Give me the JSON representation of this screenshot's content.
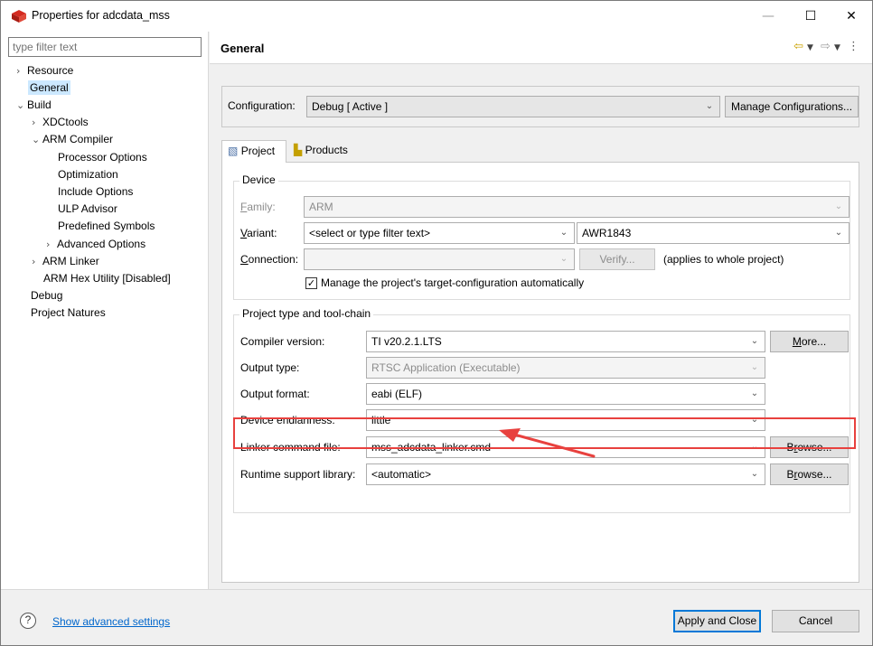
{
  "window": {
    "title": "Properties for adcdata_mss",
    "minimize": "—",
    "maximize": "☐",
    "close": "✕"
  },
  "filter": {
    "placeholder": "type filter text"
  },
  "tree": [
    {
      "label": "Resource",
      "chev": "›"
    },
    {
      "label": "General",
      "chev": ""
    },
    {
      "label": "Build",
      "chev": "⌄"
    },
    {
      "label": "XDCtools",
      "chev": "›"
    },
    {
      "label": "ARM Compiler",
      "chev": "⌄"
    },
    {
      "label": "Processor Options",
      "chev": ""
    },
    {
      "label": "Optimization",
      "chev": ""
    },
    {
      "label": "Include Options",
      "chev": ""
    },
    {
      "label": "ULP Advisor",
      "chev": ""
    },
    {
      "label": "Predefined Symbols",
      "chev": ""
    },
    {
      "label": "Advanced Options",
      "chev": "›"
    },
    {
      "label": "ARM Linker",
      "chev": "›"
    },
    {
      "label": "ARM Hex Utility  [Disabled]",
      "chev": ""
    },
    {
      "label": "Debug",
      "chev": ""
    },
    {
      "label": "Project Natures",
      "chev": ""
    }
  ],
  "page": {
    "title": "General"
  },
  "configuration": {
    "label": "Configuration:",
    "value": "Debug  [ Active ]",
    "manage_button": "Manage Configurations..."
  },
  "tabs": [
    {
      "label": "Project"
    },
    {
      "label": "Products"
    }
  ],
  "device": {
    "group_title": "Device",
    "family_label_u": "F",
    "family_label_rest": "amily:",
    "family_value": "ARM",
    "variant_label_u": "V",
    "variant_label_rest": "ariant:",
    "variant_filter": "<select or type filter text>",
    "variant_value": "AWR1843",
    "connection_label_u": "C",
    "connection_label_rest": "onnection:",
    "connection_value": "",
    "verify_button": "Verify...",
    "applies_note": "(applies to whole project)",
    "manage_checkbox": "Manage the project's target-configuration automatically",
    "manage_checked": "✓"
  },
  "toolchain": {
    "group_title": "Project type and tool-chain",
    "compiler_label": "Compiler version:",
    "compiler_value": "TI v20.2.1.LTS",
    "more_button_u": "M",
    "more_button_rest": "ore...",
    "output_type_label": "Output type:",
    "output_type_value": "RTSC Application (Executable)",
    "output_format_label": "Output format:",
    "output_format_value": "eabi (ELF)",
    "endianness_label": "Device endianness:",
    "endianness_value": "little",
    "linker_label": "Linker command file:",
    "linker_value": "mss_adcdata_linker.cmd",
    "browse_button_a": "B",
    "browse_button_u": "r",
    "browse_button_rest": "owse...",
    "runtime_label": "Runtime support library:",
    "runtime_value": "<automatic>"
  },
  "bottom": {
    "help_icon": "?",
    "advanced_link": "Show advanced settings",
    "apply_button": "Apply and Close",
    "cancel_button": "Cancel"
  },
  "colors": {
    "annotation": "#e8413e",
    "link": "#0066cc",
    "selection": "#cce8ff"
  }
}
